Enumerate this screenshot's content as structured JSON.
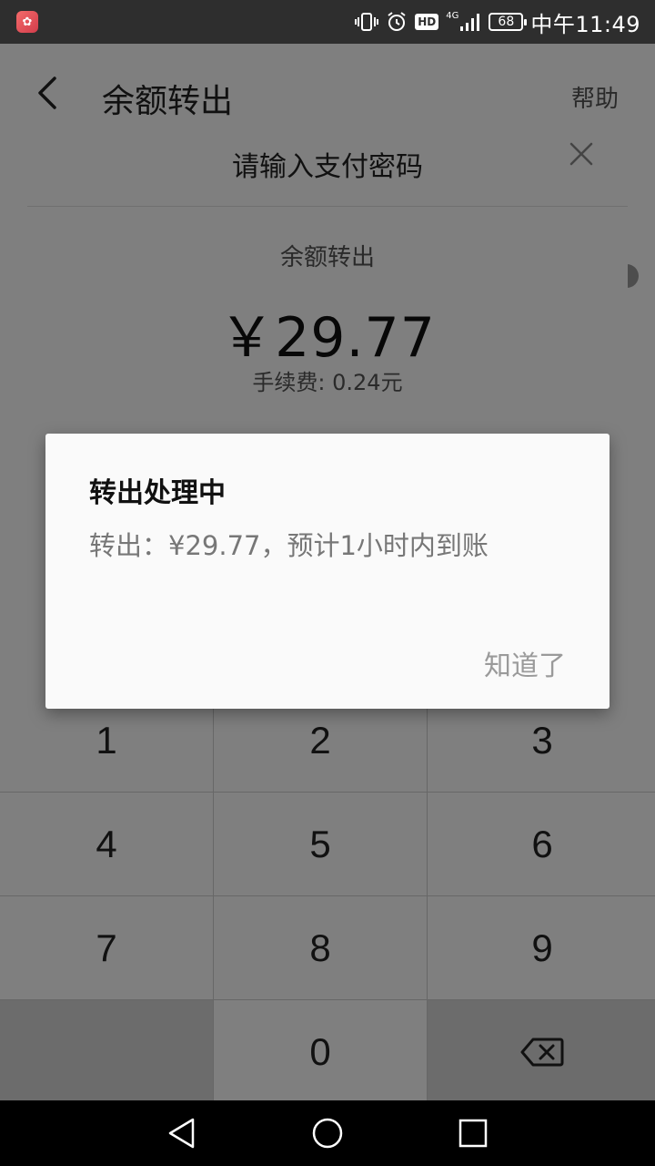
{
  "status_bar": {
    "battery_level": "68",
    "network_label": "4G",
    "hd_label": "HD",
    "time": "中午11:49"
  },
  "header": {
    "title": "余额转出",
    "help_label": "帮助"
  },
  "password_sheet": {
    "title": "请输入支付密码",
    "label": "余额转出",
    "amount": "￥29.77",
    "fee": "手续费: 0.24元"
  },
  "dialog": {
    "title": "转出处理中",
    "message": "转出：¥29.77，预计1小时内到账",
    "button_label": "知道了"
  },
  "keypad": {
    "keys": [
      "1",
      "2",
      "3",
      "4",
      "5",
      "6",
      "7",
      "8",
      "9",
      "0"
    ]
  },
  "icons": {
    "back": "chevron-left-icon",
    "close": "close-icon",
    "backspace": "backspace-icon",
    "nav_back": "triangle-back-icon",
    "nav_home": "circle-home-icon",
    "nav_recent": "square-recent-icon"
  },
  "colors": {
    "status_bar": "#2e2e2e",
    "overlay": "rgba(0,0,0,0.5)",
    "dialog_bg": "#fafafa",
    "nav_bar": "#000000"
  }
}
